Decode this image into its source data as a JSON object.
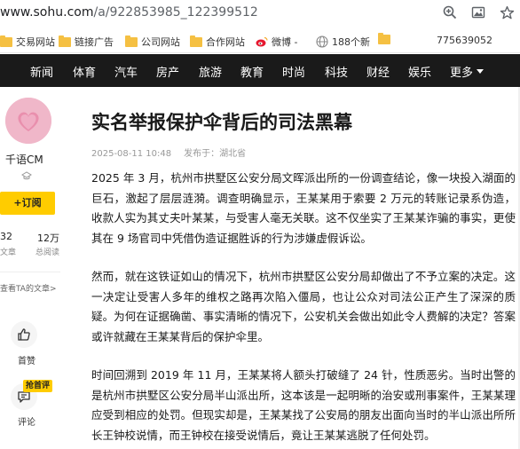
{
  "browser": {
    "url_domain": "www.sohu.com",
    "url_path": "/a/922853985_122399512"
  },
  "bookmarks": {
    "items": [
      {
        "label": "交易网站",
        "icon": "folder-icon"
      },
      {
        "label": "链接广告",
        "icon": "folder-icon"
      },
      {
        "label": "公司网站",
        "icon": "folder-icon"
      },
      {
        "label": "合作网站",
        "icon": "folder-icon"
      },
      {
        "label": "微博 -",
        "icon": "weibo-icon"
      },
      {
        "label": "188个新",
        "icon": "globe-icon"
      },
      {
        "label": "",
        "icon": "folder-icon"
      },
      {
        "label": "775639052",
        "icon": ""
      }
    ]
  },
  "nav": {
    "items": [
      "新闻",
      "体育",
      "汽车",
      "房产",
      "旅游",
      "教育",
      "时尚",
      "科技",
      "财经",
      "娱乐"
    ],
    "more": "更多"
  },
  "author": {
    "name": "千语CM",
    "follow": "+订阅",
    "stats": [
      {
        "value": "32",
        "label": "文章"
      },
      {
        "value": "12万",
        "label": "总阅读"
      }
    ],
    "view_all": "查看TA的文章>"
  },
  "actions": {
    "like": "首赞",
    "comment": "评论",
    "hot_badge": "抢首评"
  },
  "article": {
    "title": "实名举报保护伞背后的司法黑幕",
    "date": "2025-08-11 10:48",
    "source": "发布于：湖北省",
    "paragraphs": [
      "2025 年 3 月，杭州市拱墅区公安分局文晖派出所的一份调查结论，像一块投入湖面的巨石，激起了层层涟漪。调查明确显示，王某某用于索要 2 万元的转账记录系伪造，收款人实为其丈夫叶某某，与受害人毫无关联。这不仅坐实了王某某诈骗的事实，更使其在 9 场官司中凭借伪造证据胜诉的行为涉嫌虚假诉讼。",
      "然而，就在这铁证如山的情况下，杭州市拱墅区公安分局却做出了不予立案的决定。这一决定让受害人多年的维权之路再次陷入僵局，也让公众对司法公正产生了深深的质疑。为何在证据确凿、事实清晰的情况下，公安机关会做出如此令人费解的决定？答案或许就藏在王某某背后的保护伞里。",
      "时间回溯到 2019 年 11 月，王某某将人额头打破缝了 24 针，性质恶劣。当时出警的是杭州市拱墅区公安分局半山派出所，这本该是一起明晰的治安或刑事案件，王某某理应受到相应的处罚。但现实却是，王某某找了公安局的朋友出面向当时的半山派出所所长王钟校说情，而王钟校在接受说情后，竟让王某某逃脱了任何处罚。"
    ]
  }
}
